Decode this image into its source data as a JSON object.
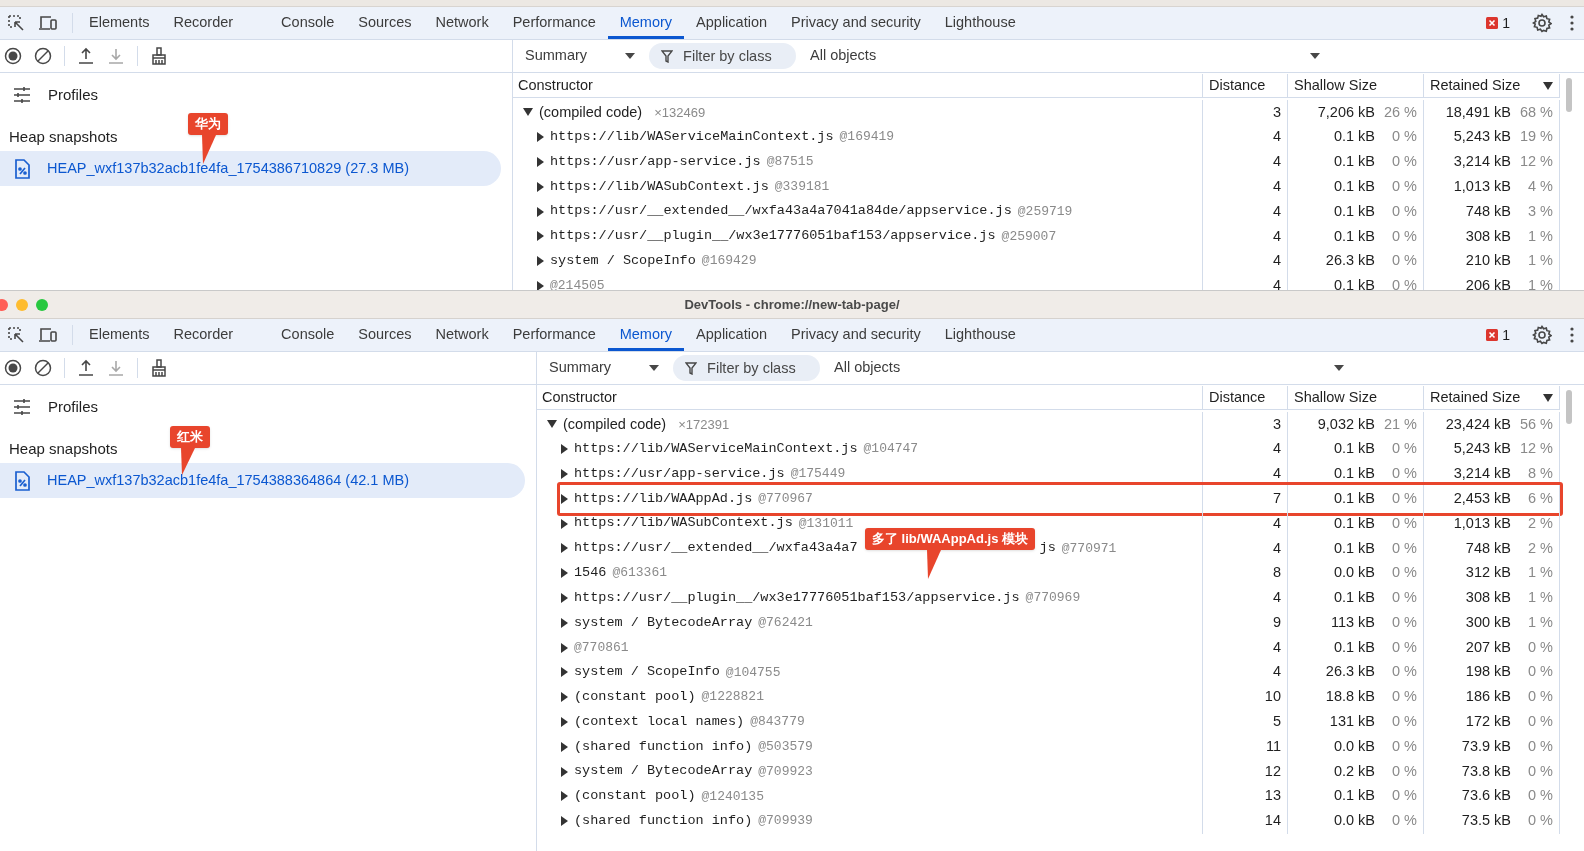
{
  "panels": [
    {
      "tabs": [
        {
          "label": "Elements",
          "selected": false
        },
        {
          "label": "Recorder",
          "selected": false
        },
        {
          "label": "Console",
          "selected": false
        },
        {
          "label": "Sources",
          "selected": false
        },
        {
          "label": "Network",
          "selected": false
        },
        {
          "label": "Performance",
          "selected": false
        },
        {
          "label": "Memory",
          "selected": true
        },
        {
          "label": "Application",
          "selected": false
        },
        {
          "label": "Privacy and security",
          "selected": false
        },
        {
          "label": "Lighthouse",
          "selected": false
        }
      ],
      "error_count": "1",
      "view": "Summary",
      "filter_placeholder": "Filter by class",
      "objects": "All objects",
      "profiles_label": "Profiles",
      "section": "Heap snapshots",
      "snapshots": [
        {
          "label": "HEAP_wxf137b32acb1fe4fa_1754386710829 (27.3 MB)",
          "selected": true
        }
      ],
      "callout": "华为",
      "columns": [
        "Constructor",
        "Distance",
        "Shallow Size",
        "Retained Size"
      ],
      "rows": [
        {
          "name": "(compiled code)",
          "count": "×132469",
          "distance": "3",
          "shallow": "7,206 kB",
          "shallow_pct": "26 %",
          "retained": "18,491 kB",
          "retained_pct": "68 %",
          "expanded": true,
          "children": [
            {
              "name": "https://lib/WAServiceMainContext.js",
              "id": "@169419",
              "distance": "4",
              "shallow": "0.1 kB",
              "shallow_pct": "0 %",
              "retained": "5,243 kB",
              "retained_pct": "19 %",
              "expanded": false
            },
            {
              "name": "https://usr/app-service.js",
              "id": "@87515",
              "distance": "4",
              "shallow": "0.1 kB",
              "shallow_pct": "0 %",
              "retained": "3,214 kB",
              "retained_pct": "12 %",
              "expanded": false
            },
            {
              "name": "https://lib/WASubContext.js",
              "id": "@339181",
              "distance": "4",
              "shallow": "0.1 kB",
              "shallow_pct": "0 %",
              "retained": "1,013 kB",
              "retained_pct": "4 %",
              "expanded": false
            },
            {
              "name": "https://usr/__extended__/wxfa43a4a7041a84de/appservice.js",
              "id": "@259719",
              "distance": "4",
              "shallow": "0.1 kB",
              "shallow_pct": "0 %",
              "retained": "748 kB",
              "retained_pct": "3 %",
              "expanded": false
            },
            {
              "name": "https://usr/__plugin__/wx3e17776051baf153/appservice.js",
              "id": "@259007",
              "distance": "4",
              "shallow": "0.1 kB",
              "shallow_pct": "0 %",
              "retained": "308 kB",
              "retained_pct": "1 %",
              "expanded": false
            },
            {
              "name": "system / ScopeInfo",
              "id": "@169429",
              "distance": "4",
              "shallow": "26.3 kB",
              "shallow_pct": "0 %",
              "retained": "210 kB",
              "retained_pct": "1 %",
              "expanded": false
            },
            {
              "id": "@214505",
              "distance": "4",
              "shallow": "0.1 kB",
              "shallow_pct": "0 %",
              "retained": "206 kB",
              "retained_pct": "1 %",
              "expanded": false
            }
          ]
        }
      ]
    },
    {
      "title": "DevTools - chrome://new-tab-page/",
      "tabs": [
        {
          "label": "Elements",
          "selected": false
        },
        {
          "label": "Recorder",
          "selected": false
        },
        {
          "label": "Console",
          "selected": false
        },
        {
          "label": "Sources",
          "selected": false
        },
        {
          "label": "Network",
          "selected": false
        },
        {
          "label": "Performance",
          "selected": false
        },
        {
          "label": "Memory",
          "selected": true
        },
        {
          "label": "Application",
          "selected": false
        },
        {
          "label": "Privacy and security",
          "selected": false
        },
        {
          "label": "Lighthouse",
          "selected": false
        }
      ],
      "error_count": "1",
      "view": "Summary",
      "filter_placeholder": "Filter by class",
      "objects": "All objects",
      "profiles_label": "Profiles",
      "section": "Heap snapshots",
      "snapshots": [
        {
          "label": "HEAP_wxf137b32acb1fe4fa_1754388364864 (42.1 MB)",
          "selected": true
        }
      ],
      "callout": "红米",
      "columns": [
        "Constructor",
        "Distance",
        "Shallow Size",
        "Retained Size"
      ],
      "table_callout": "多了 lib/WAAppAd.js 模块",
      "rows": [
        {
          "name": "(compiled code)",
          "count": "×172391",
          "distance": "3",
          "shallow": "9,032 kB",
          "shallow_pct": "21 %",
          "retained": "23,424 kB",
          "retained_pct": "56 %",
          "expanded": true,
          "children": [
            {
              "name": "https://lib/WAServiceMainContext.js",
              "id": "@104747",
              "distance": "4",
              "shallow": "0.1 kB",
              "shallow_pct": "0 %",
              "retained": "5,243 kB",
              "retained_pct": "12 %",
              "expanded": false
            },
            {
              "name": "https://usr/app-service.js",
              "id": "@175449",
              "distance": "4",
              "shallow": "0.1 kB",
              "shallow_pct": "0 %",
              "retained": "3,214 kB",
              "retained_pct": "8 %",
              "expanded": false
            },
            {
              "name": "https://lib/WAAppAd.js",
              "id": "@770967",
              "distance": "7",
              "shallow": "0.1 kB",
              "shallow_pct": "0 %",
              "retained": "2,453 kB",
              "retained_pct": "6 %",
              "expanded": false,
              "highlighted": true
            },
            {
              "name": "https://lib/WASubContext.js",
              "id": "@131011",
              "distance": "4",
              "shallow": "0.1 kB",
              "shallow_pct": "0 %",
              "retained": "1,013 kB",
              "retained_pct": "2 %",
              "expanded": false
            },
            {
              "name": "https://usr/__extended__/wxfa43a4a7",
              "name_tail": "js",
              "id": "@770971",
              "distance": "4",
              "shallow": "0.1 kB",
              "shallow_pct": "0 %",
              "retained": "748 kB",
              "retained_pct": "2 %",
              "expanded": false
            },
            {
              "name": "1546",
              "id": "@613361",
              "distance": "8",
              "shallow": "0.0 kB",
              "shallow_pct": "0 %",
              "retained": "312 kB",
              "retained_pct": "1 %",
              "expanded": false
            },
            {
              "name": "https://usr/__plugin__/wx3e17776051baf153/appservice.js",
              "id": "@770969",
              "distance": "4",
              "shallow": "0.1 kB",
              "shallow_pct": "0 %",
              "retained": "308 kB",
              "retained_pct": "1 %",
              "expanded": false
            },
            {
              "name": "system / BytecodeArray",
              "id": "@762421",
              "distance": "9",
              "shallow": "113 kB",
              "shallow_pct": "0 %",
              "retained": "300 kB",
              "retained_pct": "1 %",
              "expanded": false
            },
            {
              "id": "@770861",
              "distance": "4",
              "shallow": "0.1 kB",
              "shallow_pct": "0 %",
              "retained": "207 kB",
              "retained_pct": "0 %",
              "expanded": false
            },
            {
              "name": "system / ScopeInfo",
              "id": "@104755",
              "distance": "4",
              "shallow": "26.3 kB",
              "shallow_pct": "0 %",
              "retained": "198 kB",
              "retained_pct": "0 %",
              "expanded": false
            },
            {
              "name": "(constant pool)",
              "id": "@1228821",
              "distance": "10",
              "shallow": "18.8 kB",
              "shallow_pct": "0 %",
              "retained": "186 kB",
              "retained_pct": "0 %",
              "expanded": false
            },
            {
              "name": "(context local names)",
              "id": "@843779",
              "distance": "5",
              "shallow": "131 kB",
              "shallow_pct": "0 %",
              "retained": "172 kB",
              "retained_pct": "0 %",
              "expanded": false
            },
            {
              "name": "(shared function info)",
              "id": "@503579",
              "distance": "11",
              "shallow": "0.0 kB",
              "shallow_pct": "0 %",
              "retained": "73.9 kB",
              "retained_pct": "0 %",
              "expanded": false
            },
            {
              "name": "system / BytecodeArray",
              "id": "@709923",
              "distance": "12",
              "shallow": "0.2 kB",
              "shallow_pct": "0 %",
              "retained": "73.8 kB",
              "retained_pct": "0 %",
              "expanded": false
            },
            {
              "name": "(constant pool)",
              "id": "@1240135",
              "distance": "13",
              "shallow": "0.1 kB",
              "shallow_pct": "0 %",
              "retained": "73.6 kB",
              "retained_pct": "0 %",
              "expanded": false
            },
            {
              "name": "(shared function info)",
              "id": "@709939",
              "distance": "14",
              "shallow": "0.0 kB",
              "shallow_pct": "0 %",
              "retained": "73.5 kB",
              "retained_pct": "0 %",
              "expanded": false
            }
          ]
        }
      ]
    }
  ]
}
